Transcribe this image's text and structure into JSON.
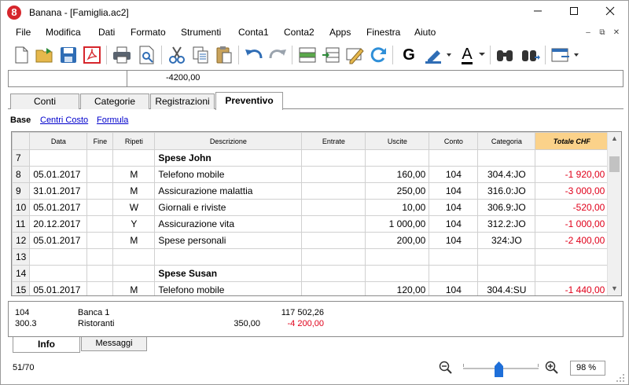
{
  "window": {
    "title": "Banana - [Famiglia.ac2]",
    "app_icon_glyph": "8"
  },
  "menubar": {
    "items": [
      "File",
      "Modifica",
      "Dati",
      "Formato",
      "Strumenti",
      "Conta1",
      "Conta2",
      "Apps",
      "Finestra",
      "Aiuto"
    ]
  },
  "toolbar": {
    "icons": [
      "new-file-icon",
      "open-folder-icon",
      "save-icon",
      "pdf-icon",
      "print-icon",
      "print-preview-icon",
      "cut-icon",
      "copy-icon",
      "paste-icon",
      "undo-icon",
      "redo-icon",
      "insert-row-icon",
      "move-rows-icon",
      "edit-icon",
      "recheck-icon",
      "bold-icon",
      "highlight-icon",
      "font-color-icon",
      "find-icon",
      "find-next-icon",
      "window-icon"
    ],
    "bold_glyph": "G",
    "font_color_glyph": "A"
  },
  "formula_bar": {
    "cell_ref": "",
    "value": "-4200,00"
  },
  "tabs": [
    "Conti",
    "Categorie",
    "Registrazioni",
    "Preventivo"
  ],
  "active_tab": "Preventivo",
  "views": {
    "current": "Base",
    "links": [
      "Centri Costo",
      "Formula"
    ]
  },
  "table": {
    "columns": [
      "",
      "Data",
      "Fine",
      "Ripeti",
      "Descrizione",
      "Entrate",
      "Uscite",
      "Conto",
      "Categoria",
      "Totale CHF"
    ],
    "rows": [
      {
        "n": "7",
        "data": "",
        "fine": "",
        "ripeti": "",
        "desc": "Spese John",
        "entrate": "",
        "uscite": "",
        "conto": "",
        "cat": "",
        "totale": "",
        "bold": true
      },
      {
        "n": "8",
        "data": "05.01.2017",
        "fine": "",
        "ripeti": "M",
        "desc": "Telefono mobile",
        "entrate": "",
        "uscite": "160,00",
        "conto": "104",
        "cat": "304.4:JO",
        "totale": "-1 920,00"
      },
      {
        "n": "9",
        "data": "31.01.2017",
        "fine": "",
        "ripeti": "M",
        "desc": "Assicurazione malattia",
        "entrate": "",
        "uscite": "250,00",
        "conto": "104",
        "cat": "316.0:JO",
        "totale": "-3 000,00"
      },
      {
        "n": "10",
        "data": "05.01.2017",
        "fine": "",
        "ripeti": "W",
        "desc": "Giornali e riviste",
        "entrate": "",
        "uscite": "10,00",
        "conto": "104",
        "cat": "306.9:JO",
        "totale": "-520,00"
      },
      {
        "n": "11",
        "data": "20.12.2017",
        "fine": "",
        "ripeti": "Y",
        "desc": "Assicurazione vita",
        "entrate": "",
        "uscite": "1 000,00",
        "conto": "104",
        "cat": "312.2:JO",
        "totale": "-1 000,00"
      },
      {
        "n": "12",
        "data": "05.01.2017",
        "fine": "",
        "ripeti": "M",
        "desc": "Spese personali",
        "entrate": "",
        "uscite": "200,00",
        "conto": "104",
        "cat": "324:JO",
        "totale": "-2 400,00"
      },
      {
        "n": "13",
        "data": "",
        "fine": "",
        "ripeti": "",
        "desc": "",
        "entrate": "",
        "uscite": "",
        "conto": "",
        "cat": "",
        "totale": ""
      },
      {
        "n": "14",
        "data": "",
        "fine": "",
        "ripeti": "",
        "desc": "Spese Susan",
        "entrate": "",
        "uscite": "",
        "conto": "",
        "cat": "",
        "totale": "",
        "bold": true
      },
      {
        "n": "15",
        "data": "05.01.2017",
        "fine": "",
        "ripeti": "M",
        "desc": "Telefono mobile",
        "entrate": "",
        "uscite": "120,00",
        "conto": "104",
        "cat": "304.4:SU",
        "totale": "-1 440,00"
      }
    ]
  },
  "info": {
    "rows": [
      {
        "account": "104",
        "name": "Banca 1",
        "amount": "",
        "balance": "117 502,26",
        "negative": false
      },
      {
        "account": "300.3",
        "name": "Ristoranti",
        "amount": "350,00",
        "balance": "-4 200,00",
        "negative": true
      }
    ]
  },
  "bottom_tabs": [
    "Info",
    "Messaggi"
  ],
  "active_bottom_tab": "Info",
  "status": {
    "counter": "51/70",
    "zoom": "98 %",
    "zoom_level": 0.47
  },
  "colors": {
    "negative": "#e0001a",
    "highlight_header": "#fbd28a",
    "link": "#0000cc"
  }
}
